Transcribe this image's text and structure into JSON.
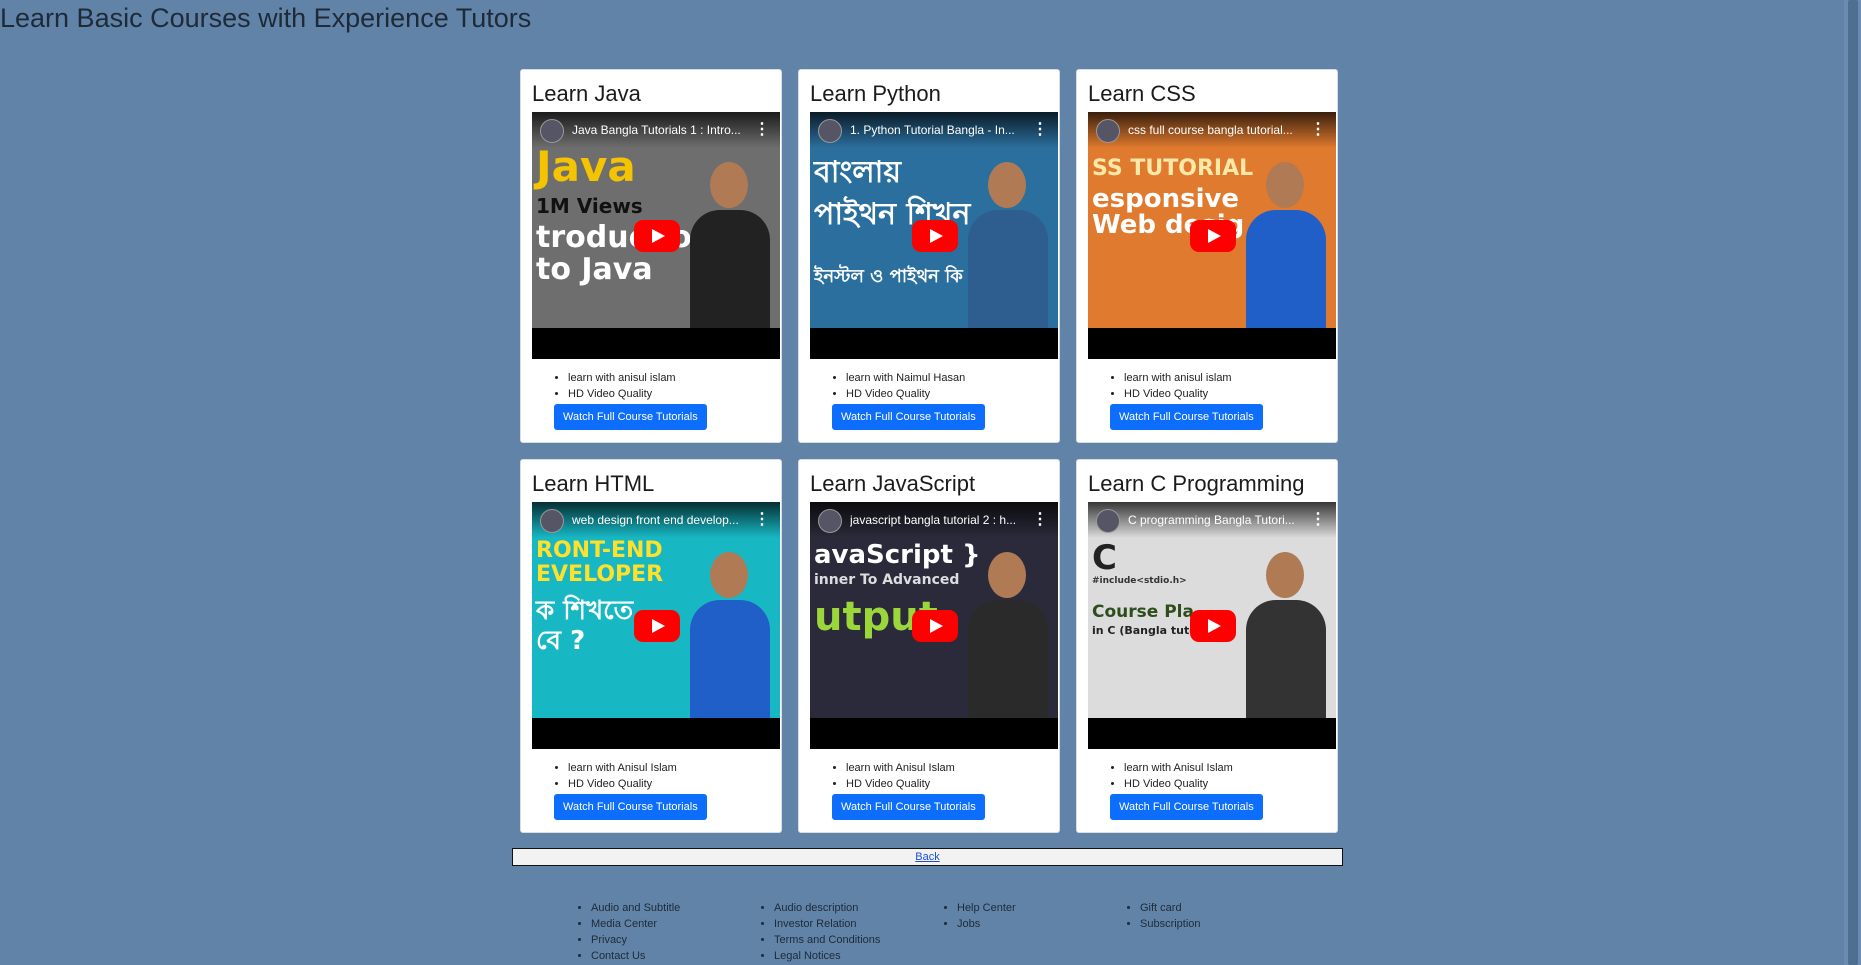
{
  "page": {
    "title": "Learn Basic Courses with Experience Tutors"
  },
  "colors": {
    "background": "#6183a8",
    "button": "#0d6efd",
    "play": "#ff0000"
  },
  "courses": [
    {
      "title": "Learn Java",
      "video_title": "Java Bangla Tutorials 1 : Intro...",
      "thumb_color": "#6e6e6e",
      "thumb_lines": [
        "Java",
        "1M Views",
        "troduction",
        "to Java"
      ],
      "tutor": "learn with anisul islam",
      "quality": "HD Video Quality",
      "button": "Watch Full Course Tutorials"
    },
    {
      "title": "Learn Python",
      "video_title": "1. Python Tutorial Bangla - In...",
      "thumb_color": "#2b6f9e",
      "thumb_lines": [
        "বাংলায়",
        "পাইথন শিখুন",
        "",
        "ইনস্টল ও পাইথন কি কাজে ল"
      ],
      "tutor": "learn with Naimul Hasan",
      "quality": "HD Video Quality",
      "button": "Watch Full Course Tutorials"
    },
    {
      "title": "Learn CSS",
      "video_title": "css full course bangla tutorial...",
      "thumb_color": "#e07a2e",
      "thumb_lines": [
        "SS TUTORIAL",
        "esponsive",
        "Web desig",
        ""
      ],
      "tutor": "learn with anisul islam",
      "quality": "HD Video Quality",
      "button": "Watch Full Course Tutorials"
    },
    {
      "title": "Learn HTML",
      "video_title": "web design front end develop...",
      "thumb_color": "#17b8c4",
      "thumb_lines": [
        "RONT-END",
        "EVELOPER",
        "ক শিখতে",
        "বে ?"
      ],
      "tutor": "learn with Anisul Islam",
      "quality": "HD Video Quality",
      "button": "Watch Full Course Tutorials"
    },
    {
      "title": "Learn JavaScript",
      "video_title": "javascript bangla tutorial 2 : h...",
      "thumb_color": "#2a2a3a",
      "thumb_lines": [
        "avaScript }",
        "inner To Advanced",
        "utput",
        ""
      ],
      "tutor": "learn with Anisul Islam",
      "quality": "HD Video Quality",
      "button": "Watch Full Course Tutorials"
    },
    {
      "title": "Learn C Programming",
      "video_title": "C programming Bangla Tutori...",
      "thumb_color": "#dcdcdc",
      "thumb_lines": [
        "C",
        "#include<stdio.h>",
        "Course Pla",
        "in C (Bangla tutorial)"
      ],
      "tutor": "learn with Anisul Islam",
      "quality": "HD Video Quality",
      "button": "Watch Full Course Tutorials"
    }
  ],
  "back": {
    "label": "Back"
  },
  "footer": {
    "columns": [
      [
        "Audio and Subtitle",
        "Media Center",
        "Privacy",
        "Contact Us"
      ],
      [
        "Audio description",
        "Investor Relation",
        "Terms and Conditions",
        "Legal Notices"
      ],
      [
        "Help Center",
        "Jobs"
      ],
      [
        "Gift card",
        "Subscription"
      ]
    ]
  }
}
